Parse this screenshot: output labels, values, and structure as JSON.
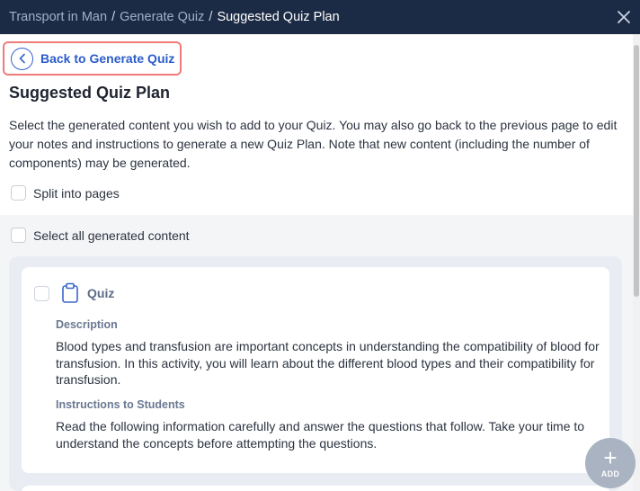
{
  "breadcrumb": {
    "items": [
      "Transport in Man",
      "Generate Quiz"
    ],
    "current": "Suggested Quiz Plan",
    "separator": "/"
  },
  "back_button": {
    "label": "Back to Generate Quiz"
  },
  "page_title": "Suggested Quiz Plan",
  "intro_text": "Select the generated content you wish to add to your Quiz. You may also go back to the previous page to edit your notes and instructions to generate a new Quiz Plan. Note that new content (including the number of components) may be generated.",
  "options": {
    "split_pages": {
      "label": "Split into pages",
      "checked": false
    },
    "select_all": {
      "label": "Select all generated content",
      "checked": false
    }
  },
  "quiz_card": {
    "type_label": "Quiz",
    "description_label": "Description",
    "description_text": "Blood types and transfusion are important concepts in understanding the compatibility of blood for transfusion. In this activity, you will learn about the different blood types and their compatibility for transfusion.",
    "instructions_label": "Instructions to Students",
    "instructions_text": "Read the following information carefully and answer the questions that follow. Take your time to understand the concepts before attempting the questions."
  },
  "fab": {
    "label": "ADD",
    "symbol": "+"
  },
  "icons": {
    "close": "close-icon",
    "back": "chevron-left-icon",
    "quiz": "clipboard-icon"
  },
  "colors": {
    "topbar": "#1c2b45",
    "accent": "#2b5bcb",
    "highlight_border": "#f07b7b",
    "fab": "#a9b3c1"
  }
}
